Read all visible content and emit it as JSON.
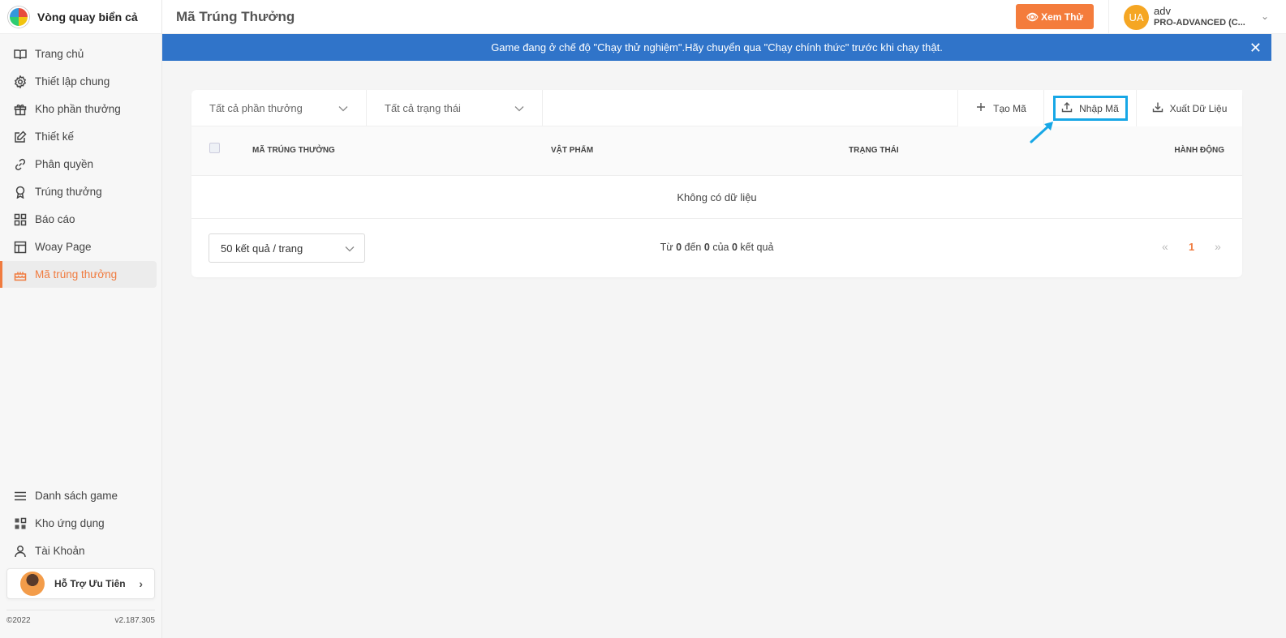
{
  "brand": {
    "name": "Vòng quay biển cả"
  },
  "sidebar": {
    "items": [
      {
        "label": "Trang chủ",
        "icon": "book-icon"
      },
      {
        "label": "Thiết lập chung",
        "icon": "gear-icon"
      },
      {
        "label": "Kho phần thưởng",
        "icon": "gift-icon"
      },
      {
        "label": "Thiết kế",
        "icon": "edit-icon"
      },
      {
        "label": "Phân quyền",
        "icon": "link-icon"
      },
      {
        "label": "Trúng thưởng",
        "icon": "award-icon"
      },
      {
        "label": "Báo cáo",
        "icon": "grid-icon"
      },
      {
        "label": "Woay Page",
        "icon": "layout-icon"
      },
      {
        "label": "Mã trúng thưởng",
        "icon": "cake-icon",
        "active": true
      }
    ],
    "bottom_items": [
      {
        "label": "Danh sách game",
        "icon": "menu-icon"
      },
      {
        "label": "Kho ứng dụng",
        "icon": "apps-icon"
      },
      {
        "label": "Tài Khoản",
        "icon": "user-icon"
      }
    ],
    "support_label": "Hỗ Trợ Ưu Tiên",
    "copyright": "©2022",
    "version": "v2.187.305"
  },
  "header": {
    "title": "Mã Trúng Thưởng",
    "preview_label": "Xem Thử",
    "user": {
      "initials": "UA",
      "name": "adv",
      "plan": "PRO-ADVANCED (C..."
    }
  },
  "banner": {
    "text": "Game đang ở chế độ \"Chạy thử nghiệm\".Hãy chuyển qua \"Chạy chính thức\" trước khi chạy thật."
  },
  "toolbar": {
    "reward_filter": "Tất cả phần thưởng",
    "status_filter": "Tất cả trạng thái",
    "create_label": "Tạo Mã",
    "import_label": "Nhập Mã",
    "export_label": "Xuất Dữ Liệu"
  },
  "table": {
    "columns": [
      "MÃ TRÚNG THƯỞNG",
      "VẬT PHẨM",
      "TRẠNG THÁI",
      "HÀNH ĐỘNG"
    ],
    "empty_text": "Không có dữ liệu"
  },
  "pagination": {
    "page_size": "50 kết quả / trang",
    "summary_prefix": "Từ",
    "from": "0",
    "summary_mid1": "đến",
    "to": "0",
    "summary_mid2": "của",
    "total": "0",
    "summary_suffix": "kết quả",
    "current_page": "1",
    "prev": "«",
    "next": "»"
  },
  "colors": {
    "accent": "#f07b3f",
    "banner": "#3074c9",
    "highlight": "#17a7e6"
  }
}
